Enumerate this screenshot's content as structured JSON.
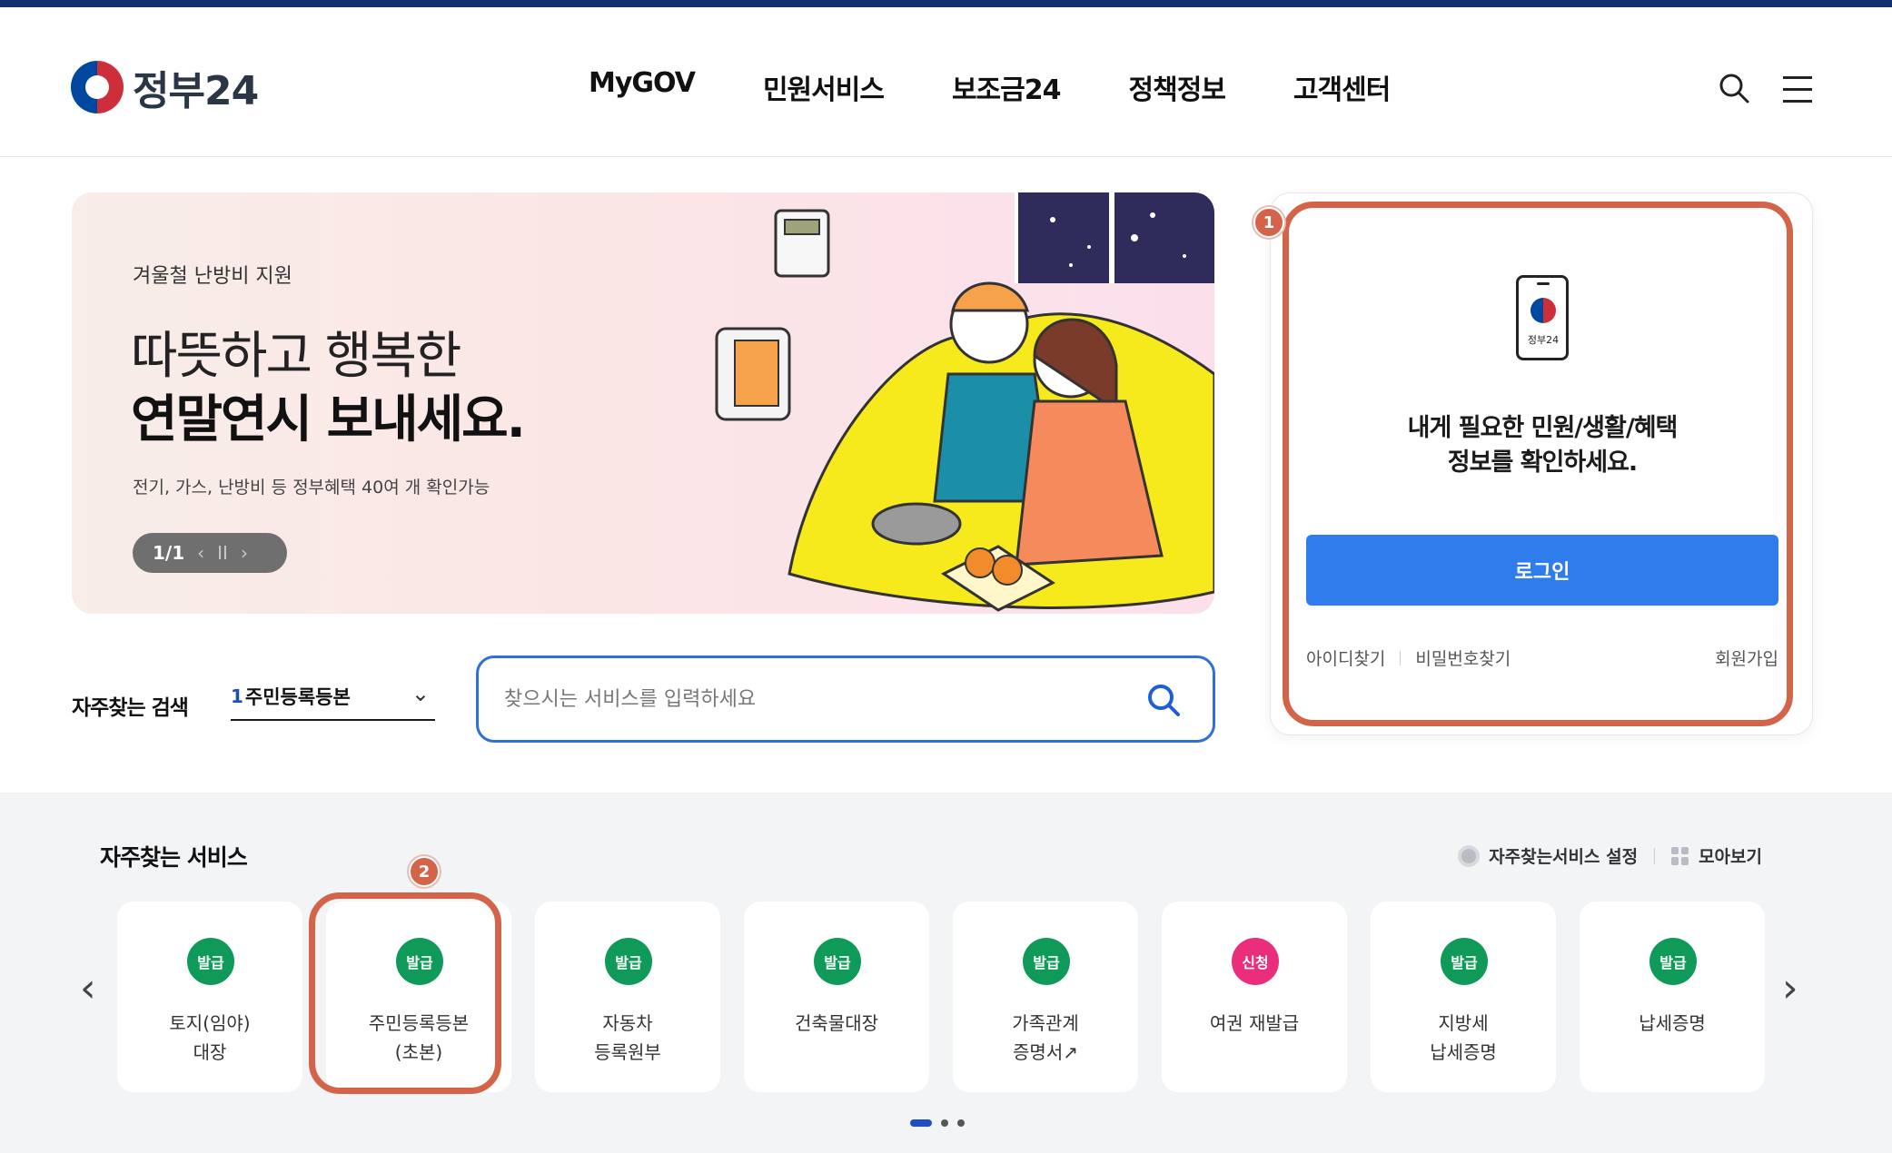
{
  "header": {
    "logo_text": "정부24",
    "nav": [
      "MyGOV",
      "민원서비스",
      "보조금24",
      "정책정보",
      "고객센터"
    ]
  },
  "banner": {
    "subtitle": "겨울철 난방비 지원",
    "title_line1": "따뜻하고 행복한",
    "title_line2": "연말연시 보내세요.",
    "description": "전기, 가스, 난방비 등 정부혜택 40여 개 확인가능",
    "pager": "1/1"
  },
  "login": {
    "phone_label": "정부24",
    "message_line1": "내게 필요한 민원/생활/혜택",
    "message_line2": "정보를 확인하세요.",
    "login_button": "로그인",
    "find_id": "아이디찾기",
    "find_password": "비밀번호찾기",
    "signup": "회원가입"
  },
  "frequent_search": {
    "label": "자주찾는 검색",
    "selected_number": "1",
    "selected_text": "주민등록등본",
    "placeholder": "찾으시는 서비스를 입력하세요"
  },
  "services": {
    "title": "자주찾는 서비스",
    "settings_label": "자주찾는서비스 설정",
    "view_all_label": "모아보기",
    "cards": [
      {
        "tag": "발급",
        "line1": "토지(임야)",
        "line2": "대장"
      },
      {
        "tag": "발급",
        "line1": "주민등록등본",
        "line2": "(초본)"
      },
      {
        "tag": "발급",
        "line1": "자동차",
        "line2": "등록원부"
      },
      {
        "tag": "발급",
        "line1": "건축물대장",
        "line2": ""
      },
      {
        "tag": "발급",
        "line1": "가족관계",
        "line2": "증명서↗"
      },
      {
        "tag": "신청",
        "line1": "여권 재발급",
        "line2": ""
      },
      {
        "tag": "발급",
        "line1": "지방세",
        "line2": "납세증명"
      },
      {
        "tag": "발급",
        "line1": "납세증명",
        "line2": ""
      }
    ]
  },
  "annotations": {
    "badge1": "1",
    "badge2": "2"
  },
  "colors": {
    "primary": "#2f7cec",
    "issue_tag": "#0f9a5a",
    "apply_tag": "#ea2e7c",
    "highlight": "#d36449",
    "topbar": "#10316b"
  }
}
